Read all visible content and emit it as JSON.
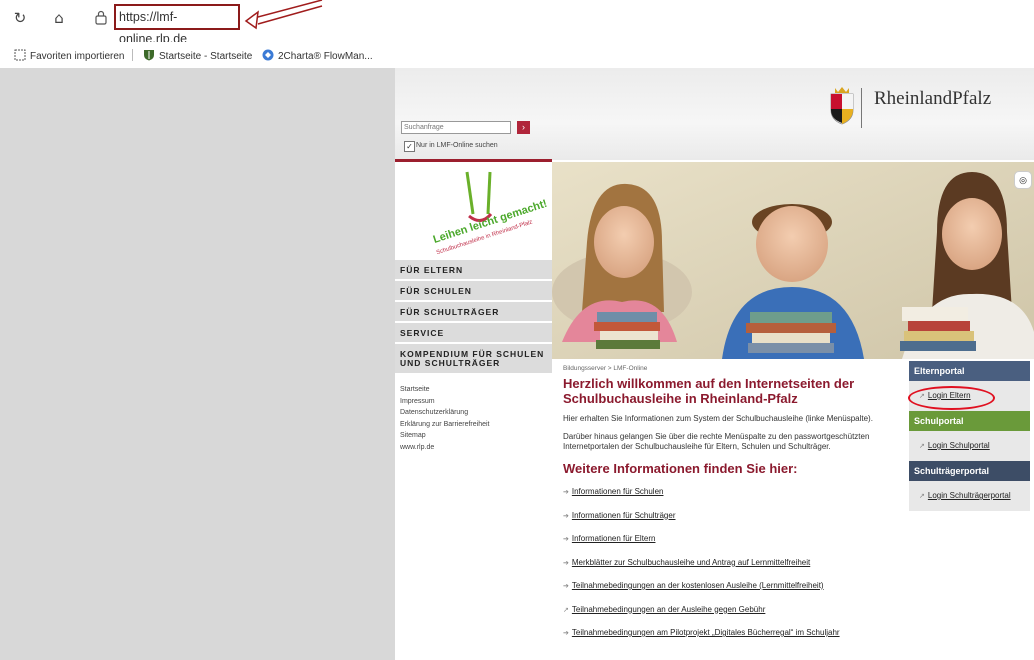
{
  "browser": {
    "url": "https://lmf-online.rlp.de",
    "favorites": [
      {
        "label": "Favoriten importieren",
        "icon": "import-icon"
      },
      {
        "label": "Startseite - Startseite",
        "icon": "shield-icon"
      },
      {
        "label": "2Charta® FlowMan...",
        "icon": "globe-icon"
      }
    ]
  },
  "header": {
    "search_placeholder": "Suchanfrage",
    "search_button": "›",
    "checkbox_label": "Nur in LMF-Online suchen",
    "logo_text": "RheinlandPfalz"
  },
  "mascot": {
    "line1": "Leihen leicht gemacht!",
    "line2": "Schulbuchausleihe in Rheinland-Pfalz"
  },
  "nav": [
    {
      "label": "FÜR ELTERN"
    },
    {
      "label": "FÜR SCHULEN"
    },
    {
      "label": "FÜR SCHULTRÄGER"
    },
    {
      "label": "SERVICE"
    },
    {
      "label": "KOMPENDIUM FÜR SCHULEN",
      "label2": "UND SCHULTRÄGER"
    }
  ],
  "sublinks": [
    "Startseite",
    "Impressum",
    "Datenschutzerklärung",
    "Erklärung zur Barrierefreiheit",
    "Sitemap",
    "www.rlp.de"
  ],
  "main": {
    "breadcrumb": "Bildungsserver > LMF-Online",
    "title": "Herzlich willkommen auf den Internetseiten der Schulbuchausleihe in Rheinland-Pfalz",
    "para1": "Hier erhalten Sie Informationen zum System der Schulbuchausleihe (linke Menüspalte).",
    "para2": "Darüber hinaus gelangen Sie über die rechte Menüspalte zu den passwortgeschützten Internetportalen der Schulbuchausleihe für Eltern, Schulen und Schulträger.",
    "subtitle": "Weitere Informationen finden Sie hier:",
    "links": [
      "Informationen für Schulen",
      "Informationen für Schulträger",
      "Informationen für Eltern",
      "Merkblätter zur Schulbuchausleihe und Antrag auf Lernmittelfreiheit",
      "Teilnahmebedingungen an der kostenlosen Ausleihe (Lernmittelfreiheit)",
      "Teilnahmebedingungen an der Ausleihe gegen Gebühr",
      "Teilnahmebedingungen am Pilotprojekt „Digitales Bücherregal“ im Schuljahr"
    ]
  },
  "portals": [
    {
      "title": "Elternportal",
      "link": "Login Eltern",
      "color": "#4a5f80"
    },
    {
      "title": "Schulportal",
      "link": "Login Schulportal",
      "color": "#6a9a3a"
    },
    {
      "title": "Schulträgerportal",
      "link": "Login Schulträgerportal",
      "color": "#3d4d66"
    }
  ]
}
